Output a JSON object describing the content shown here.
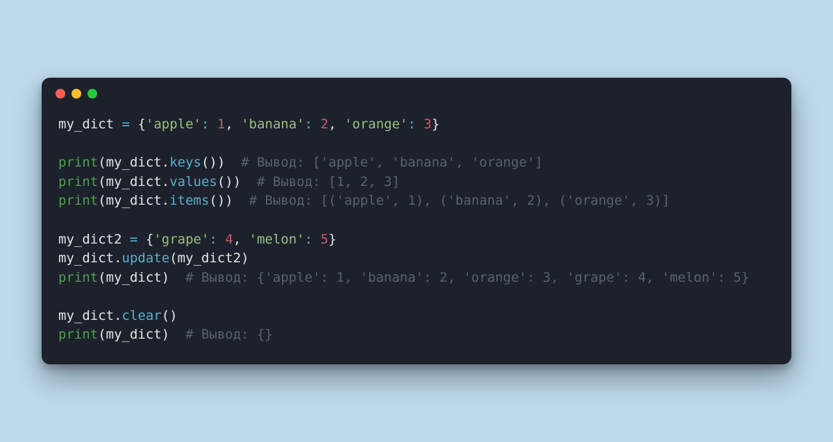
{
  "code": {
    "dict_literal": {
      "var": "my_dict",
      "eq": "=",
      "open": "{",
      "k1": "'apple'",
      "c1": ":",
      "v1": "1",
      "sep1": ", ",
      "k2": "'banana'",
      "c2": ":",
      "v2": "2",
      "sep2": ", ",
      "k3": "'orange'",
      "c3": ":",
      "v3": "3",
      "close": "}"
    },
    "print_keys": {
      "fn": "print",
      "open": "(",
      "obj": "my_dict",
      "dot": ".",
      "method": "keys",
      "call": "()",
      "close": ")",
      "comment": "# Вывод: ['apple', 'banana', 'orange']"
    },
    "print_values": {
      "fn": "print",
      "open": "(",
      "obj": "my_dict",
      "dot": ".",
      "method": "values",
      "call": "()",
      "close": ")",
      "comment": "# Вывод: [1, 2, 3]"
    },
    "print_items": {
      "fn": "print",
      "open": "(",
      "obj": "my_dict",
      "dot": ".",
      "method": "items",
      "call": "()",
      "close": ")",
      "comment": "# Вывод: [('apple', 1), ('banana', 2), ('orange', 3)]"
    },
    "dict2_literal": {
      "var": "my_dict2",
      "eq": "=",
      "open": "{",
      "k1": "'grape'",
      "c1": ":",
      "v1": "4",
      "sep1": ", ",
      "k2": "'melon'",
      "c2": ":",
      "v2": "5",
      "close": "}"
    },
    "update_call": {
      "obj": "my_dict",
      "dot": ".",
      "method": "update",
      "open": "(",
      "arg": "my_dict2",
      "close": ")"
    },
    "print_merged": {
      "fn": "print",
      "open": "(",
      "obj": "my_dict",
      "close": ")",
      "comment": "# Вывод: {'apple': 1, 'banana': 2, 'orange': 3, 'grape': 4, 'melon': 5}"
    },
    "clear_call": {
      "obj": "my_dict",
      "dot": ".",
      "method": "clear",
      "call": "()"
    },
    "print_cleared": {
      "fn": "print",
      "open": "(",
      "obj": "my_dict",
      "close": ")",
      "comment": "# Вывод: {}"
    }
  },
  "colors": {
    "background_page": "#bdd9ec",
    "background_window": "#1c212b",
    "traffic_red": "#ff5f56",
    "traffic_yellow": "#ffbd2e",
    "traffic_green": "#27c93f",
    "string": "#99c37a",
    "number": "#ce5b63",
    "function": "#59b0cf",
    "builtin": "#50a14f",
    "comment": "#5a6270",
    "operator": "#57b5d9",
    "identifier": "#e6e6e6"
  }
}
